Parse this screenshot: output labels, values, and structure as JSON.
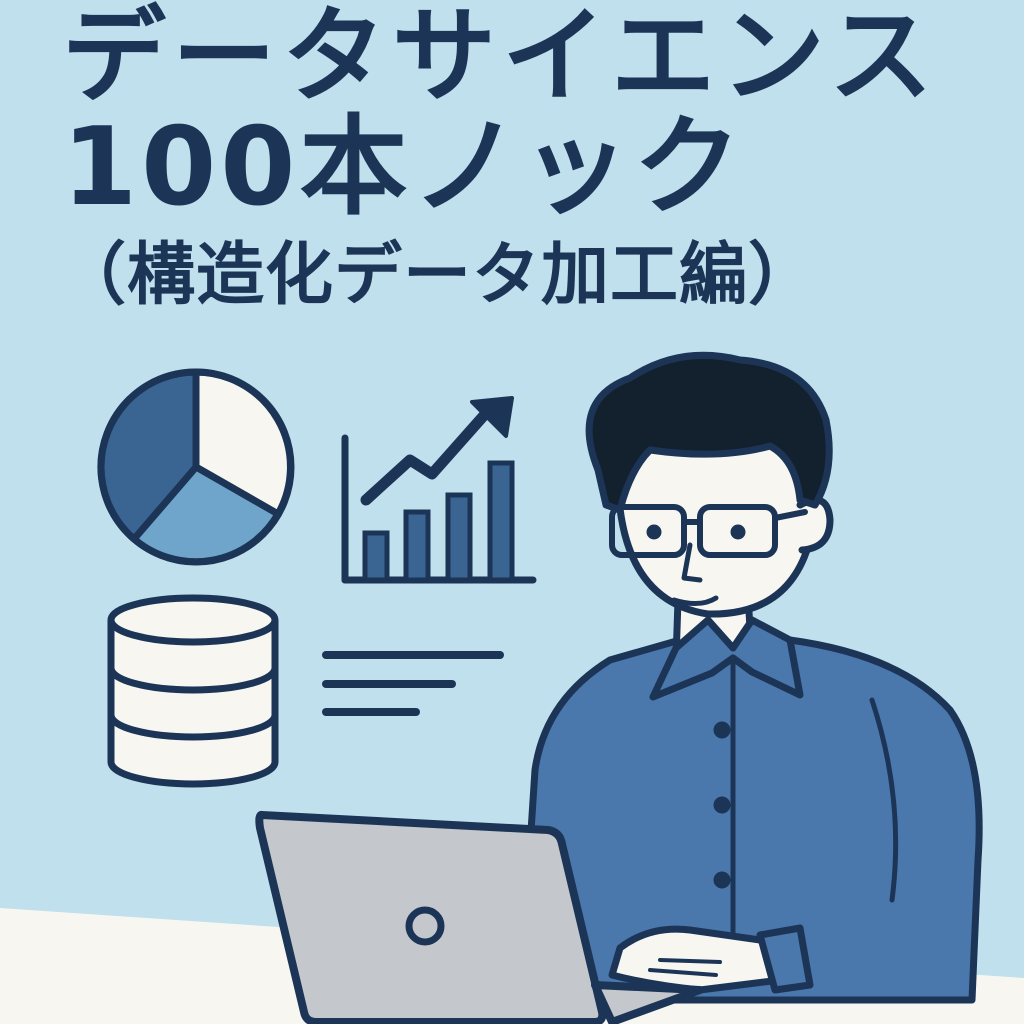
{
  "cover": {
    "title_line1": "データサイエンス",
    "title_line2": "100本ノック",
    "subtitle": "（構造化データ加工編）"
  },
  "colors": {
    "background": "#bfe0ec",
    "navy": "#1c3557",
    "shirt": "#4a78ad",
    "light_blue": "#6fa4cb",
    "off_white": "#f7f6f1",
    "laptop": "#c4c7cb"
  },
  "illustration": {
    "icons": [
      "pie-chart-icon",
      "bar-chart-icon",
      "trend-arrow-icon",
      "database-icon",
      "text-lines-icon",
      "laptop-icon"
    ],
    "figure": "person-with-glasses-using-laptop"
  }
}
